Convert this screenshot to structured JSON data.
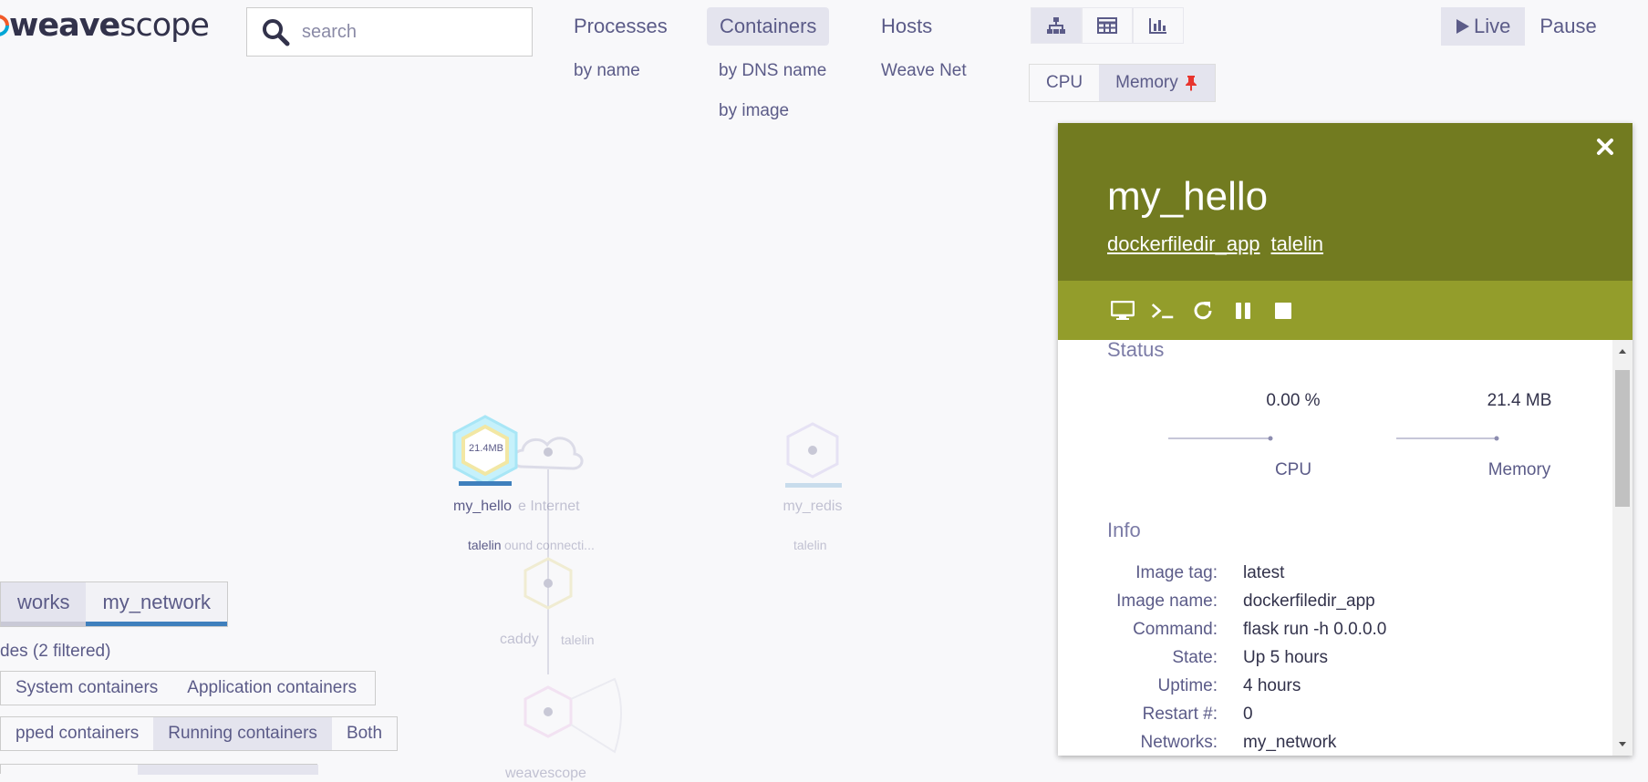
{
  "logo": {
    "weave": "weave",
    "scope": "scope"
  },
  "search": {
    "placeholder": "search"
  },
  "topologies": [
    {
      "label": "Processes",
      "subs": [
        "by name"
      ]
    },
    {
      "label": "Containers",
      "subs": [
        "by DNS name",
        "by image"
      ]
    },
    {
      "label": "Hosts",
      "subs": [
        "Weave Net"
      ]
    }
  ],
  "view_modes": [
    "graph-icon",
    "table-icon",
    "resources-icon"
  ],
  "metrics": {
    "cpu": "CPU",
    "memory": "Memory"
  },
  "live": {
    "live": "Live",
    "pause": "Pause"
  },
  "graph": {
    "my_hello": {
      "label": "my_hello",
      "sub": "talelin",
      "value": "21.4MB"
    },
    "internet": {
      "label": "e Internet",
      "sub": "ound connecti..."
    },
    "my_redis": {
      "label": "my_redis",
      "sub": "talelin"
    },
    "caddy": {
      "label": "caddy",
      "sub": "talelin"
    },
    "weavescope": {
      "label": "weavescope"
    }
  },
  "networks": {
    "tab1": "works",
    "tab2": "my_network"
  },
  "filter_status": "des (2 filtered)",
  "filters": {
    "row1": [
      "System containers",
      "Application containers"
    ],
    "row2": [
      "pped containers",
      "Running containers",
      "Both"
    ]
  },
  "panel": {
    "title": "my_hello",
    "links": [
      "dockerfiledir_app",
      "talelin"
    ],
    "status_title": "Status",
    "cpu_value": "0.00 %",
    "cpu_label": "CPU",
    "mem_value": "21.4 MB",
    "mem_label": "Memory",
    "info_title": "Info",
    "info": [
      {
        "k": "Image tag:",
        "v": "latest"
      },
      {
        "k": "Image name:",
        "v": "dockerfiledir_app"
      },
      {
        "k": "Command:",
        "v": "flask run -h 0.0.0.0"
      },
      {
        "k": "State:",
        "v": "Up 5 hours"
      },
      {
        "k": "Uptime:",
        "v": "4 hours"
      },
      {
        "k": "Restart #:",
        "v": "0"
      },
      {
        "k": "Networks:",
        "v": "my_network"
      }
    ]
  },
  "colors": {
    "panel_head": "#727b20",
    "panel_controls": "#939d2b",
    "accent": "#3f80bd"
  }
}
